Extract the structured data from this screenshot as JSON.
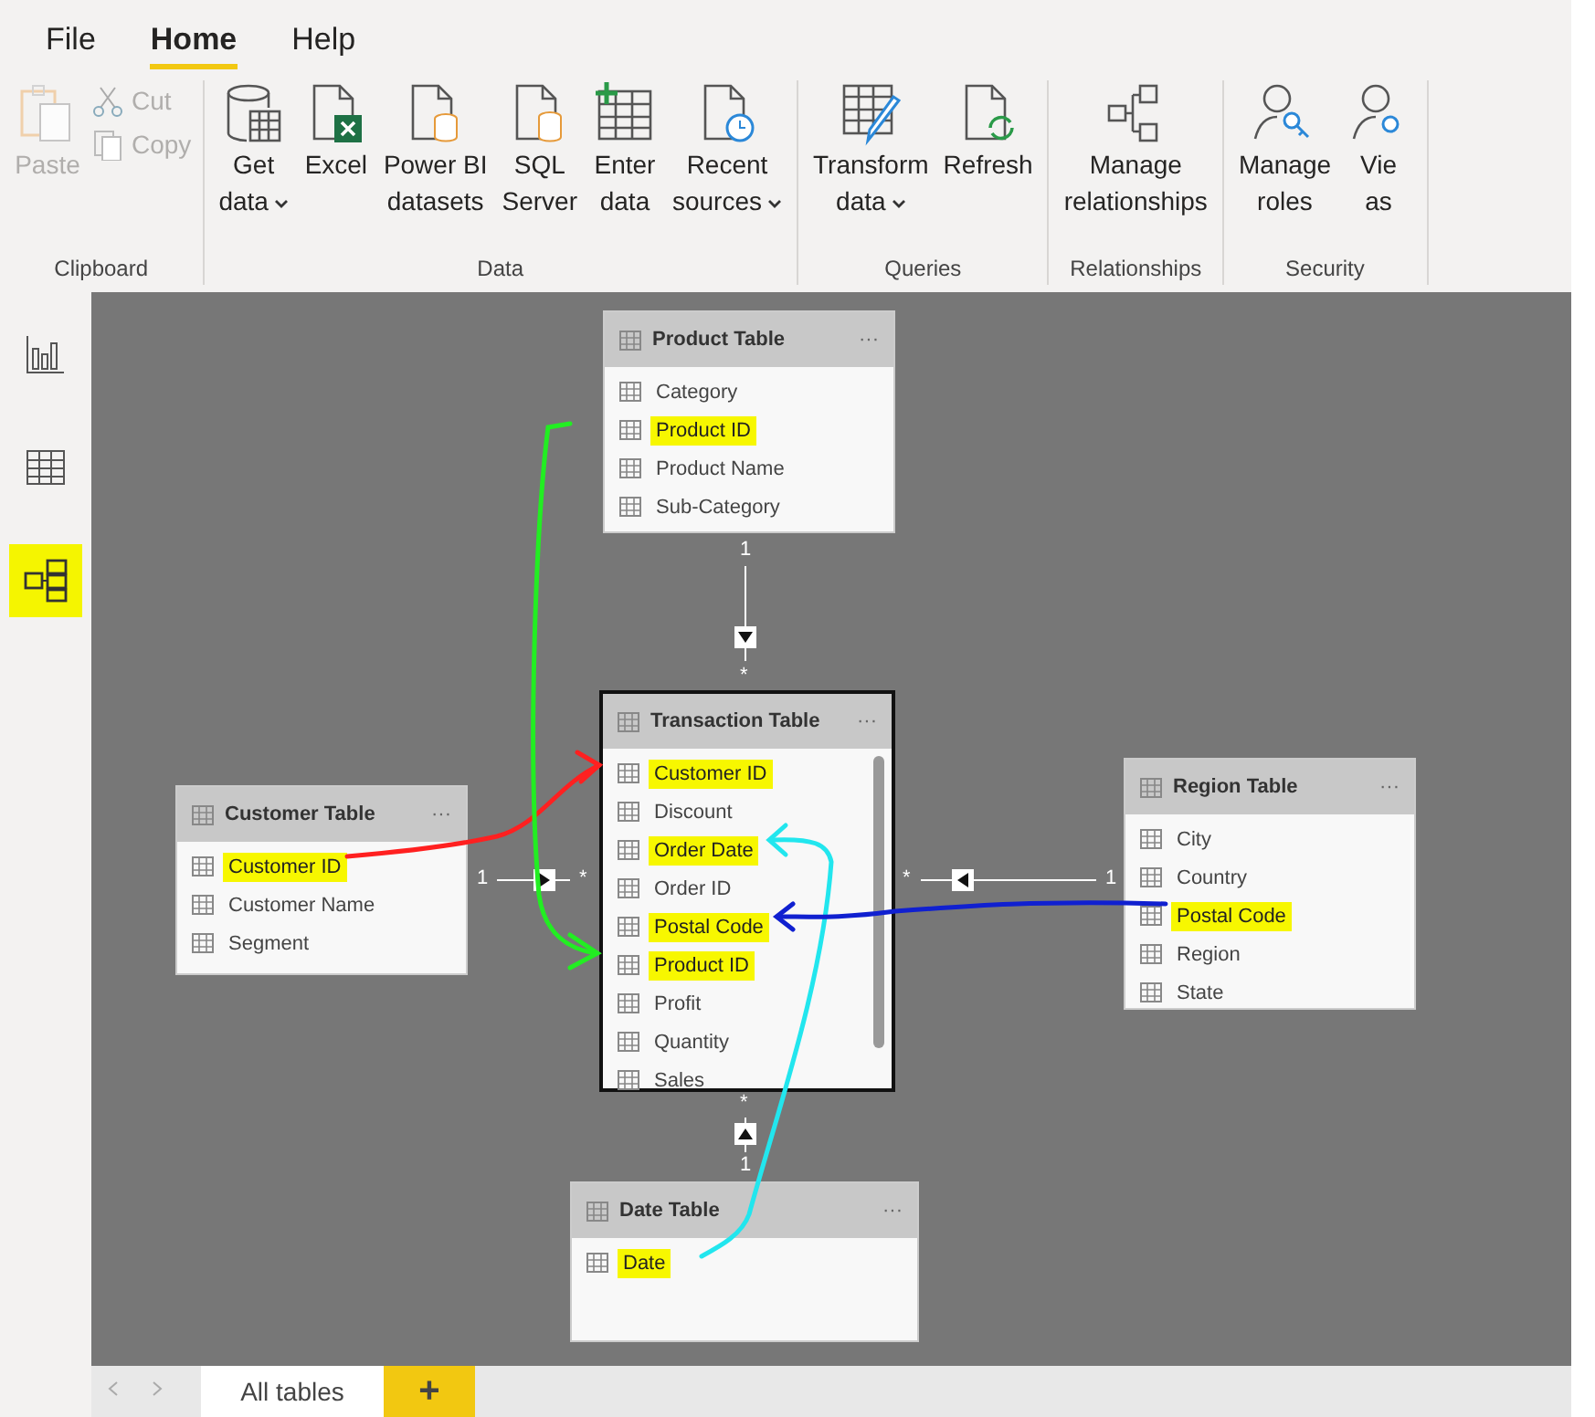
{
  "ribbon": {
    "tabs": [
      {
        "label": "File",
        "selected": false
      },
      {
        "label": "Home",
        "selected": true
      },
      {
        "label": "Help",
        "selected": false
      }
    ],
    "groups": [
      {
        "label": "Clipboard",
        "items": [
          {
            "kind": "large",
            "label": "Paste",
            "disabled": true
          },
          {
            "kind": "small",
            "label": "Cut",
            "disabled": true
          },
          {
            "kind": "small",
            "label": "Copy",
            "disabled": true
          }
        ]
      },
      {
        "label": "Data",
        "items": [
          {
            "kind": "large",
            "label": "Get\ndata",
            "dropdown": true,
            "disabled": false
          },
          {
            "kind": "large",
            "label": "Excel",
            "dropdown": false,
            "disabled": false
          },
          {
            "kind": "large",
            "label": "Power BI\ndatasets",
            "dropdown": false,
            "disabled": false
          },
          {
            "kind": "large",
            "label": "SQL\nServer",
            "dropdown": false,
            "disabled": false
          },
          {
            "kind": "large",
            "label": "Enter\ndata",
            "dropdown": false,
            "disabled": false
          },
          {
            "kind": "large",
            "label": "Recent\nsources",
            "dropdown": true,
            "disabled": false
          }
        ]
      },
      {
        "label": "Queries",
        "items": [
          {
            "kind": "large",
            "label": "Transform\ndata",
            "dropdown": true,
            "disabled": false
          },
          {
            "kind": "large",
            "label": "Refresh",
            "dropdown": false,
            "disabled": false
          }
        ]
      },
      {
        "label": "Relationships",
        "items": [
          {
            "kind": "large",
            "label": "Manage\nrelationships",
            "dropdown": false,
            "disabled": false
          }
        ]
      },
      {
        "label": "Security",
        "items": [
          {
            "kind": "large",
            "label": "Manage\nroles",
            "dropdown": false,
            "disabled": false
          },
          {
            "kind": "large",
            "label": "Vie\nas",
            "dropdown": false,
            "disabled": false
          }
        ]
      }
    ]
  },
  "view_rail": [
    {
      "kind": "report",
      "selected": false
    },
    {
      "kind": "data",
      "selected": false
    },
    {
      "kind": "model",
      "selected": true
    }
  ],
  "tables": [
    {
      "title": "Product Table",
      "kind": "dimension",
      "selected": false,
      "more": "···",
      "fields": [
        {
          "name": "Category",
          "highlighted": false
        },
        {
          "name": "Product ID",
          "highlighted": true
        },
        {
          "name": "Product Name",
          "highlighted": false
        },
        {
          "name": "Sub-Category",
          "highlighted": false
        }
      ],
      "link": {
        "one_label": "1",
        "many_label": "*"
      }
    },
    {
      "title": "Customer Table",
      "kind": "dimension",
      "selected": false,
      "more": "···",
      "fields": [
        {
          "name": "Customer ID",
          "highlighted": true
        },
        {
          "name": "Customer Name",
          "highlighted": false
        },
        {
          "name": "Segment",
          "highlighted": false
        }
      ],
      "link": {
        "one_label": "1",
        "many_label": "*"
      }
    },
    {
      "title": "Transaction Table",
      "kind": "fact",
      "selected": true,
      "more": "···",
      "fields": [
        {
          "name": "Customer ID",
          "highlighted": true
        },
        {
          "name": "Discount",
          "highlighted": false
        },
        {
          "name": "Order Date",
          "highlighted": true
        },
        {
          "name": "Order ID",
          "highlighted": false
        },
        {
          "name": "Postal Code",
          "highlighted": true
        },
        {
          "name": "Product ID",
          "highlighted": true
        },
        {
          "name": "Profit",
          "highlighted": false
        },
        {
          "name": "Quantity",
          "highlighted": false
        },
        {
          "name": "Sales",
          "highlighted": false
        }
      ]
    },
    {
      "title": "Region Table",
      "kind": "dimension",
      "selected": false,
      "more": "···",
      "fields": [
        {
          "name": "City",
          "highlighted": false
        },
        {
          "name": "Country",
          "highlighted": false
        },
        {
          "name": "Postal Code",
          "highlighted": true
        },
        {
          "name": "Region",
          "highlighted": false
        },
        {
          "name": "State",
          "highlighted": false
        }
      ],
      "link": {
        "one_label": "1",
        "many_label": "*"
      }
    },
    {
      "title": "Date Table",
      "kind": "dimension",
      "selected": false,
      "more": "···",
      "fields": [
        {
          "name": "Date",
          "highlighted": true
        }
      ],
      "link": {
        "one_label": "1",
        "many_label": "*"
      }
    }
  ],
  "page_tabs": {
    "tabs": [
      {
        "label": "All tables",
        "selected": true
      }
    ],
    "add": "+"
  }
}
